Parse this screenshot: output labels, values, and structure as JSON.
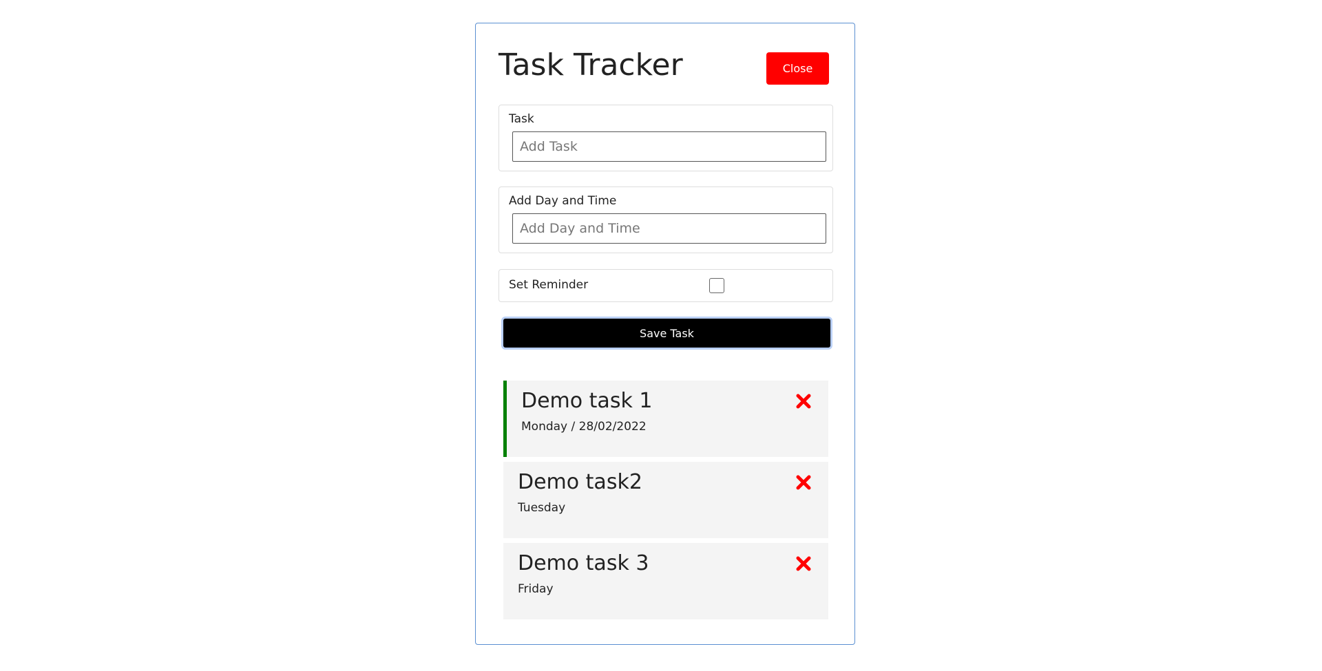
{
  "app": {
    "title": "Task Tracker",
    "close_label": "Close"
  },
  "form": {
    "task": {
      "label": "Task",
      "placeholder": "Add Task",
      "value": ""
    },
    "day": {
      "label": "Add Day and Time",
      "placeholder": "Add Day and Time",
      "value": ""
    },
    "reminder": {
      "label": "Set Reminder",
      "checked": false
    },
    "save_label": "Save Task"
  },
  "tasks": [
    {
      "text": "Demo task 1",
      "day": "Monday / 28/02/2022",
      "reminder": true,
      "delete_icon": "times-icon"
    },
    {
      "text": "Demo task2",
      "day": "Tuesday",
      "reminder": false,
      "delete_icon": "times-icon"
    },
    {
      "text": "Demo task 3",
      "day": "Friday",
      "reminder": false,
      "delete_icon": "times-icon"
    }
  ],
  "colors": {
    "close_button": "#ff0000",
    "save_button": "#000000",
    "reminder_border": "#008000",
    "delete_icon": "#ff0000"
  }
}
